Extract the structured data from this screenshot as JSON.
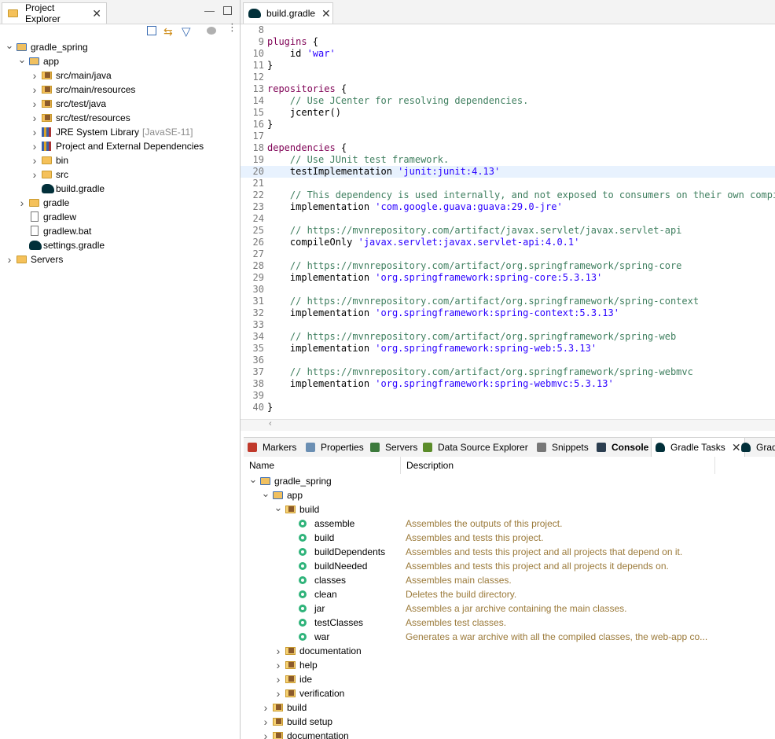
{
  "project_explorer": {
    "tab_title": "Project Explorer",
    "tree": [
      {
        "label": "gradle_spring",
        "indent": 0,
        "chev": "open",
        "icon": "project"
      },
      {
        "label": "app",
        "indent": 1,
        "chev": "open",
        "icon": "project"
      },
      {
        "label": "src/main/java",
        "indent": 2,
        "chev": "closed",
        "icon": "pkg"
      },
      {
        "label": "src/main/resources",
        "indent": 2,
        "chev": "closed",
        "icon": "pkg"
      },
      {
        "label": "src/test/java",
        "indent": 2,
        "chev": "closed",
        "icon": "pkg"
      },
      {
        "label": "src/test/resources",
        "indent": 2,
        "chev": "closed",
        "icon": "pkg"
      },
      {
        "label": "JRE System Library",
        "extra": "[JavaSE-11]",
        "indent": 2,
        "chev": "closed",
        "icon": "lib"
      },
      {
        "label": "Project and External Dependencies",
        "indent": 2,
        "chev": "closed",
        "icon": "lib"
      },
      {
        "label": "bin",
        "indent": 2,
        "chev": "closed",
        "icon": "folder"
      },
      {
        "label": "src",
        "indent": 2,
        "chev": "closed",
        "icon": "folder"
      },
      {
        "label": "build.gradle",
        "indent": 2,
        "chev": "none",
        "icon": "gradle"
      },
      {
        "label": "gradle",
        "indent": 1,
        "chev": "closed",
        "icon": "folder"
      },
      {
        "label": "gradlew",
        "indent": 1,
        "chev": "none",
        "icon": "file"
      },
      {
        "label": "gradlew.bat",
        "indent": 1,
        "chev": "none",
        "icon": "file"
      },
      {
        "label": "settings.gradle",
        "indent": 1,
        "chev": "none",
        "icon": "gradle"
      },
      {
        "label": "Servers",
        "indent": 0,
        "chev": "closed",
        "icon": "folder"
      }
    ]
  },
  "editor": {
    "tab_title": "build.gradle",
    "current_line": 20,
    "lines": [
      {
        "n": "8",
        "parts": []
      },
      {
        "n": "9",
        "parts": [
          {
            "t": "kw",
            "v": "plugins"
          },
          {
            "t": "p",
            "v": " {"
          }
        ]
      },
      {
        "n": "10",
        "parts": [
          {
            "t": "p",
            "v": "    id "
          },
          {
            "t": "str",
            "v": "'war'"
          }
        ]
      },
      {
        "n": "11",
        "parts": [
          {
            "t": "p",
            "v": "}"
          }
        ]
      },
      {
        "n": "12",
        "parts": []
      },
      {
        "n": "13",
        "parts": [
          {
            "t": "kw",
            "v": "repositories"
          },
          {
            "t": "p",
            "v": " {"
          }
        ]
      },
      {
        "n": "14",
        "parts": [
          {
            "t": "cm",
            "v": "    // Use JCenter for resolving dependencies."
          }
        ]
      },
      {
        "n": "15",
        "parts": [
          {
            "t": "p",
            "v": "    jcenter()"
          }
        ]
      },
      {
        "n": "16",
        "parts": [
          {
            "t": "p",
            "v": "}"
          }
        ]
      },
      {
        "n": "17",
        "parts": []
      },
      {
        "n": "18",
        "parts": [
          {
            "t": "kw",
            "v": "dependencies"
          },
          {
            "t": "p",
            "v": " {"
          }
        ]
      },
      {
        "n": "19",
        "parts": [
          {
            "t": "cm",
            "v": "    // Use JUnit test framework."
          }
        ]
      },
      {
        "n": "20",
        "parts": [
          {
            "t": "p",
            "v": "    testImplementation "
          },
          {
            "t": "str",
            "v": "'junit:junit:4.13'"
          }
        ]
      },
      {
        "n": "21",
        "parts": []
      },
      {
        "n": "22",
        "parts": [
          {
            "t": "cm",
            "v": "    // This dependency is used internally, and not exposed to consumers on their own compile"
          }
        ]
      },
      {
        "n": "23",
        "parts": [
          {
            "t": "p",
            "v": "    implementation "
          },
          {
            "t": "str",
            "v": "'com.google.guava:guava:29.0-jre'"
          }
        ]
      },
      {
        "n": "24",
        "parts": []
      },
      {
        "n": "25",
        "parts": [
          {
            "t": "cm",
            "v": "    // https://mvnrepository.com/artifact/javax.servlet/javax.servlet-api"
          }
        ]
      },
      {
        "n": "26",
        "parts": [
          {
            "t": "p",
            "v": "    compileOnly "
          },
          {
            "t": "str",
            "v": "'javax.servlet:javax.servlet-api:4.0.1'"
          }
        ]
      },
      {
        "n": "27",
        "parts": []
      },
      {
        "n": "28",
        "parts": [
          {
            "t": "cm",
            "v": "    // https://mvnrepository.com/artifact/org.springframework/spring-core"
          }
        ]
      },
      {
        "n": "29",
        "parts": [
          {
            "t": "p",
            "v": "    implementation "
          },
          {
            "t": "str",
            "v": "'org.springframework:spring-core:5.3.13'"
          }
        ]
      },
      {
        "n": "30",
        "parts": []
      },
      {
        "n": "31",
        "parts": [
          {
            "t": "cm",
            "v": "    // https://mvnrepository.com/artifact/org.springframework/spring-context"
          }
        ]
      },
      {
        "n": "32",
        "parts": [
          {
            "t": "p",
            "v": "    implementation "
          },
          {
            "t": "str",
            "v": "'org.springframework:spring-context:5.3.13'"
          }
        ]
      },
      {
        "n": "33",
        "parts": []
      },
      {
        "n": "34",
        "parts": [
          {
            "t": "cm",
            "v": "    // https://mvnrepository.com/artifact/org.springframework/spring-web"
          }
        ]
      },
      {
        "n": "35",
        "parts": [
          {
            "t": "p",
            "v": "    implementation "
          },
          {
            "t": "str",
            "v": "'org.springframework:spring-web:5.3.13'"
          }
        ]
      },
      {
        "n": "36",
        "parts": []
      },
      {
        "n": "37",
        "parts": [
          {
            "t": "cm",
            "v": "    // https://mvnrepository.com/artifact/org.springframework/spring-webmvc"
          }
        ]
      },
      {
        "n": "38",
        "parts": [
          {
            "t": "p",
            "v": "    implementation "
          },
          {
            "t": "str",
            "v": "'org.springframework:spring-webmvc:5.3.13'"
          }
        ]
      },
      {
        "n": "39",
        "parts": []
      },
      {
        "n": "40",
        "parts": [
          {
            "t": "p",
            "v": "}"
          }
        ]
      }
    ]
  },
  "bottom_tabs": [
    {
      "label": "Markers",
      "icon": "markers-icon"
    },
    {
      "label": "Properties",
      "icon": "properties-icon"
    },
    {
      "label": "Servers",
      "icon": "servers-icon"
    },
    {
      "label": "Data Source Explorer",
      "icon": "datasource-icon"
    },
    {
      "label": "Snippets",
      "icon": "snippets-icon"
    },
    {
      "label": "Console",
      "icon": "console-icon",
      "bold": true
    },
    {
      "label": "Gradle Tasks",
      "icon": "gradle-icon",
      "active": true
    },
    {
      "label": "Grad",
      "icon": "gradle-icon"
    }
  ],
  "gradle_tasks": {
    "col_name": "Name",
    "col_desc": "Description",
    "rows": [
      {
        "label": "gradle_spring",
        "indent": 0,
        "chev": "open",
        "icon": "project",
        "desc": ""
      },
      {
        "label": "app",
        "indent": 1,
        "chev": "open",
        "icon": "project",
        "desc": ""
      },
      {
        "label": "build",
        "indent": 2,
        "chev": "open",
        "icon": "taskfolder",
        "desc": ""
      },
      {
        "label": "assemble",
        "indent": 3,
        "chev": "none",
        "icon": "task",
        "desc": "Assembles the outputs of this project."
      },
      {
        "label": "build",
        "indent": 3,
        "chev": "none",
        "icon": "task",
        "desc": "Assembles and tests this project."
      },
      {
        "label": "buildDependents",
        "indent": 3,
        "chev": "none",
        "icon": "task",
        "desc": "Assembles and tests this project and all projects that depend on it."
      },
      {
        "label": "buildNeeded",
        "indent": 3,
        "chev": "none",
        "icon": "task",
        "desc": "Assembles and tests this project and all projects it depends on."
      },
      {
        "label": "classes",
        "indent": 3,
        "chev": "none",
        "icon": "task",
        "desc": "Assembles main classes."
      },
      {
        "label": "clean",
        "indent": 3,
        "chev": "none",
        "icon": "task",
        "desc": "Deletes the build directory."
      },
      {
        "label": "jar",
        "indent": 3,
        "chev": "none",
        "icon": "task",
        "desc": "Assembles a jar archive containing the main classes."
      },
      {
        "label": "testClasses",
        "indent": 3,
        "chev": "none",
        "icon": "task",
        "desc": "Assembles test classes."
      },
      {
        "label": "war",
        "indent": 3,
        "chev": "none",
        "icon": "task",
        "desc": "Generates a war archive with all the compiled classes, the web-app co..."
      },
      {
        "label": "documentation",
        "indent": 2,
        "chev": "closed",
        "icon": "taskfolder",
        "desc": ""
      },
      {
        "label": "help",
        "indent": 2,
        "chev": "closed",
        "icon": "taskfolder",
        "desc": ""
      },
      {
        "label": "ide",
        "indent": 2,
        "chev": "closed",
        "icon": "taskfolder",
        "desc": ""
      },
      {
        "label": "verification",
        "indent": 2,
        "chev": "closed",
        "icon": "taskfolder",
        "desc": ""
      },
      {
        "label": "build",
        "indent": 1,
        "chev": "closed",
        "icon": "taskfolder",
        "desc": ""
      },
      {
        "label": "build setup",
        "indent": 1,
        "chev": "closed",
        "icon": "taskfolder",
        "desc": ""
      },
      {
        "label": "documentation",
        "indent": 1,
        "chev": "closed",
        "icon": "taskfolder",
        "desc": ""
      }
    ]
  }
}
